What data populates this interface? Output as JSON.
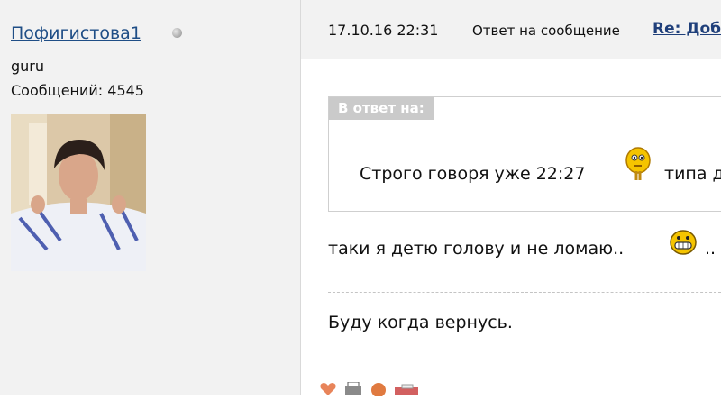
{
  "user": {
    "name": "Пофигистова1",
    "rank": "guru",
    "posts": "Сообщений: 4545"
  },
  "post": {
    "date": "17.10.16 22:31",
    "reply_prefix": "Ответ на сообщение",
    "thread_link": "Re: Доб",
    "quote": {
      "label": "В ответ на:",
      "text": "Строго говоря уже 22:27",
      "text_after": "типа д"
    },
    "line1": "таки я детю голову и не ломаю..",
    "line1_tail": "..",
    "line2": "Буду когда вернусь."
  },
  "icons": {
    "status": "status-offline-icon",
    "smiley1": "thinking-smiley-icon",
    "smiley2": "grin-smiley-icon",
    "actions": [
      "heart-icon",
      "print-icon",
      "reply-icon",
      "bookmark-icon"
    ]
  }
}
